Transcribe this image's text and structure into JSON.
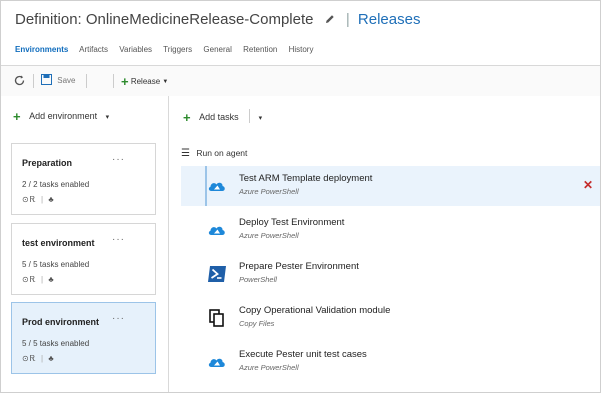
{
  "header": {
    "title": "Definition: OnlineMedicineRelease-Complete",
    "releases_link": "Releases",
    "tabs": [
      "Environments",
      "Artifacts",
      "Variables",
      "Triggers",
      "General",
      "Retention",
      "History"
    ],
    "active_tab": "Environments"
  },
  "toolbar": {
    "refresh_icon": "refresh-icon",
    "save_label": "Save",
    "release_label": "Release"
  },
  "left": {
    "add_environment_label": "Add environment",
    "environments": [
      {
        "name": "Preparation",
        "tasks": "2 / 2 tasks enabled",
        "selected": false
      },
      {
        "name": "test environment",
        "tasks": "5 / 5 tasks enabled",
        "selected": false
      },
      {
        "name": "Prod environment",
        "tasks": "5 / 5 tasks enabled",
        "selected": true
      }
    ],
    "more_label": "···"
  },
  "right": {
    "add_tasks_label": "Add tasks",
    "run_on_agent_label": "Run on agent",
    "tasks": [
      {
        "name": "Test ARM Template deployment",
        "type": "Azure PowerShell",
        "icon": "azure-cloud-icon",
        "selected": true
      },
      {
        "name": "Deploy Test Environment",
        "type": "Azure PowerShell",
        "icon": "azure-cloud-icon",
        "selected": false
      },
      {
        "name": "Prepare Pester Environment",
        "type": "PowerShell",
        "icon": "powershell-icon",
        "selected": false
      },
      {
        "name": "Copy Operational Validation module",
        "type": "Copy Files",
        "icon": "copy-files-icon",
        "selected": false
      },
      {
        "name": "Execute Pester unit test cases",
        "type": "Azure PowerShell",
        "icon": "azure-cloud-icon",
        "selected": false
      }
    ]
  },
  "colors": {
    "accent_blue": "#0f6cbd",
    "selection_bg": "#eaf3fc",
    "add_green": "#2e8b2e",
    "delete_red": "#c42b2b",
    "azure_blue": "#1e88d9",
    "powershell_blue": "#1f5fa8"
  }
}
